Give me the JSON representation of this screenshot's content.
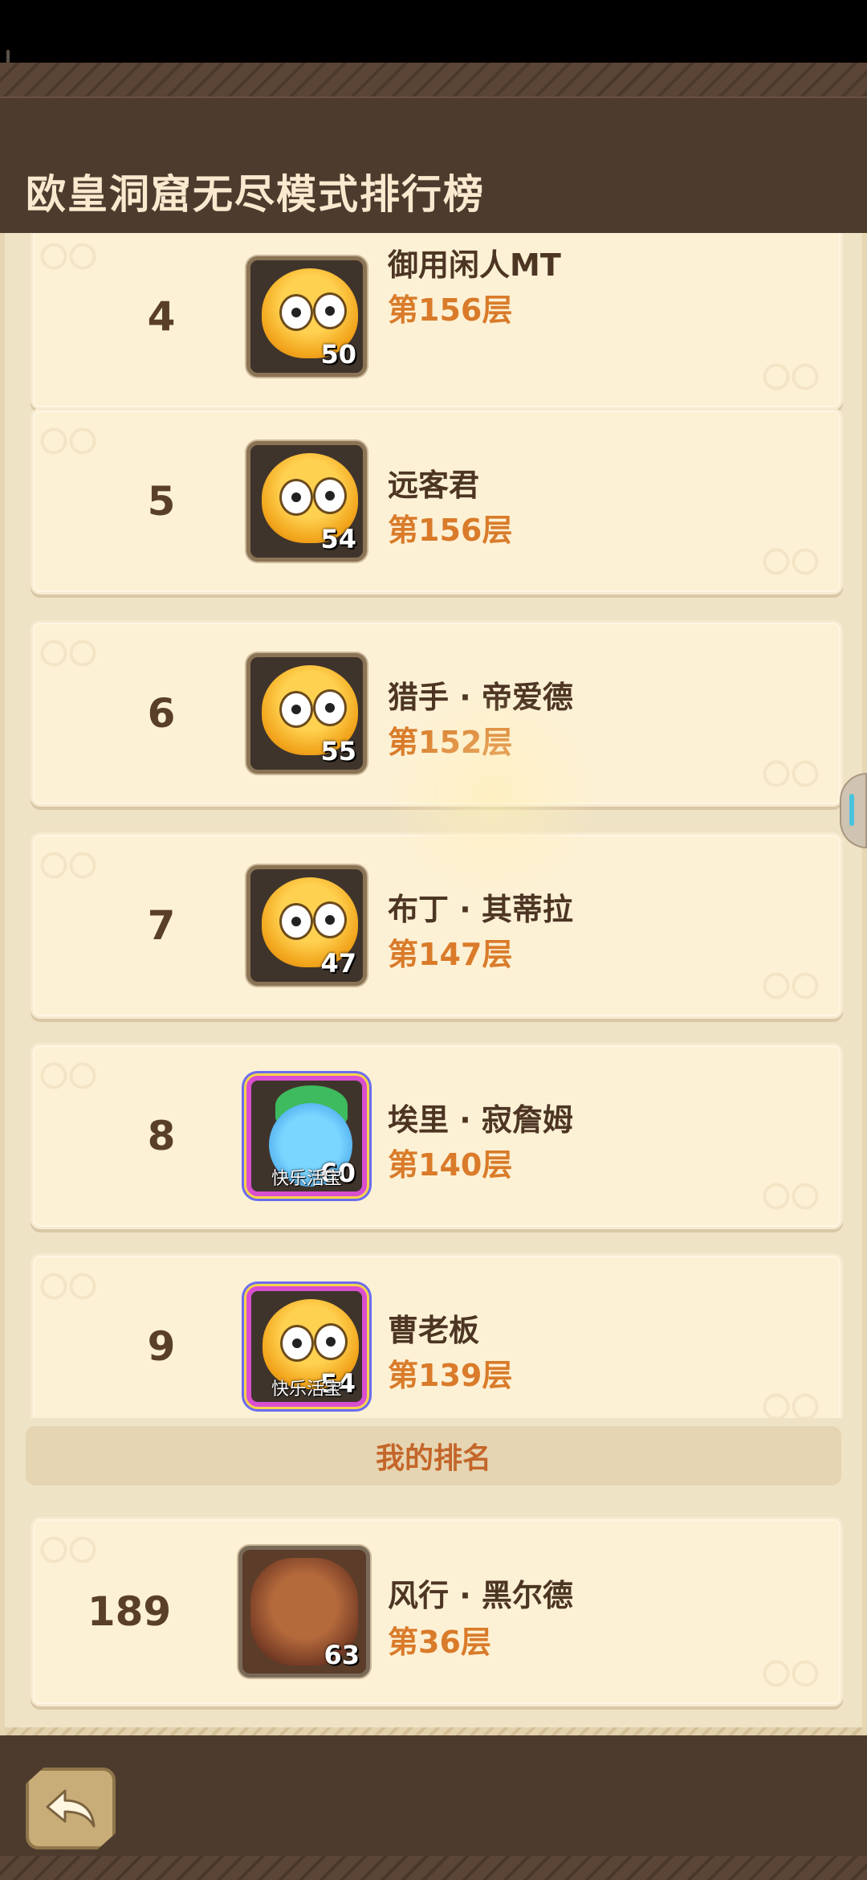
{
  "header": {
    "title": "欧皇洞窟无尽模式排行榜"
  },
  "rankings": [
    {
      "rank": "4",
      "name": "御用闲人MT",
      "floor": "第156层",
      "level": "50",
      "tag": ""
    },
    {
      "rank": "5",
      "name": "远客君",
      "floor": "第156层",
      "level": "54",
      "tag": ""
    },
    {
      "rank": "6",
      "name": "猎手 · 帝爱德",
      "floor": "第152层",
      "level": "55",
      "tag": ""
    },
    {
      "rank": "7",
      "name": "布丁 · 其蒂拉",
      "floor": "第147层",
      "level": "47",
      "tag": ""
    },
    {
      "rank": "8",
      "name": "埃里 · 寂詹姆",
      "floor": "第140层",
      "level": "60",
      "tag": "快乐活宝"
    },
    {
      "rank": "9",
      "name": "曹老板",
      "floor": "第139层",
      "level": "54",
      "tag": "快乐活宝"
    }
  ],
  "my_rank": {
    "label": "我的排名",
    "rank": "189",
    "name": "风行 · 黑尔德",
    "floor": "第36层",
    "level": "63"
  },
  "icons": {
    "back": "back-arrow-icon",
    "side_tab": "side-handle-icon"
  },
  "colors": {
    "header_bg": "#4d3b2e",
    "panel_bg": "#efe3c5",
    "floor_text": "#d97b2a",
    "my_rank_label": "#c4662a"
  }
}
